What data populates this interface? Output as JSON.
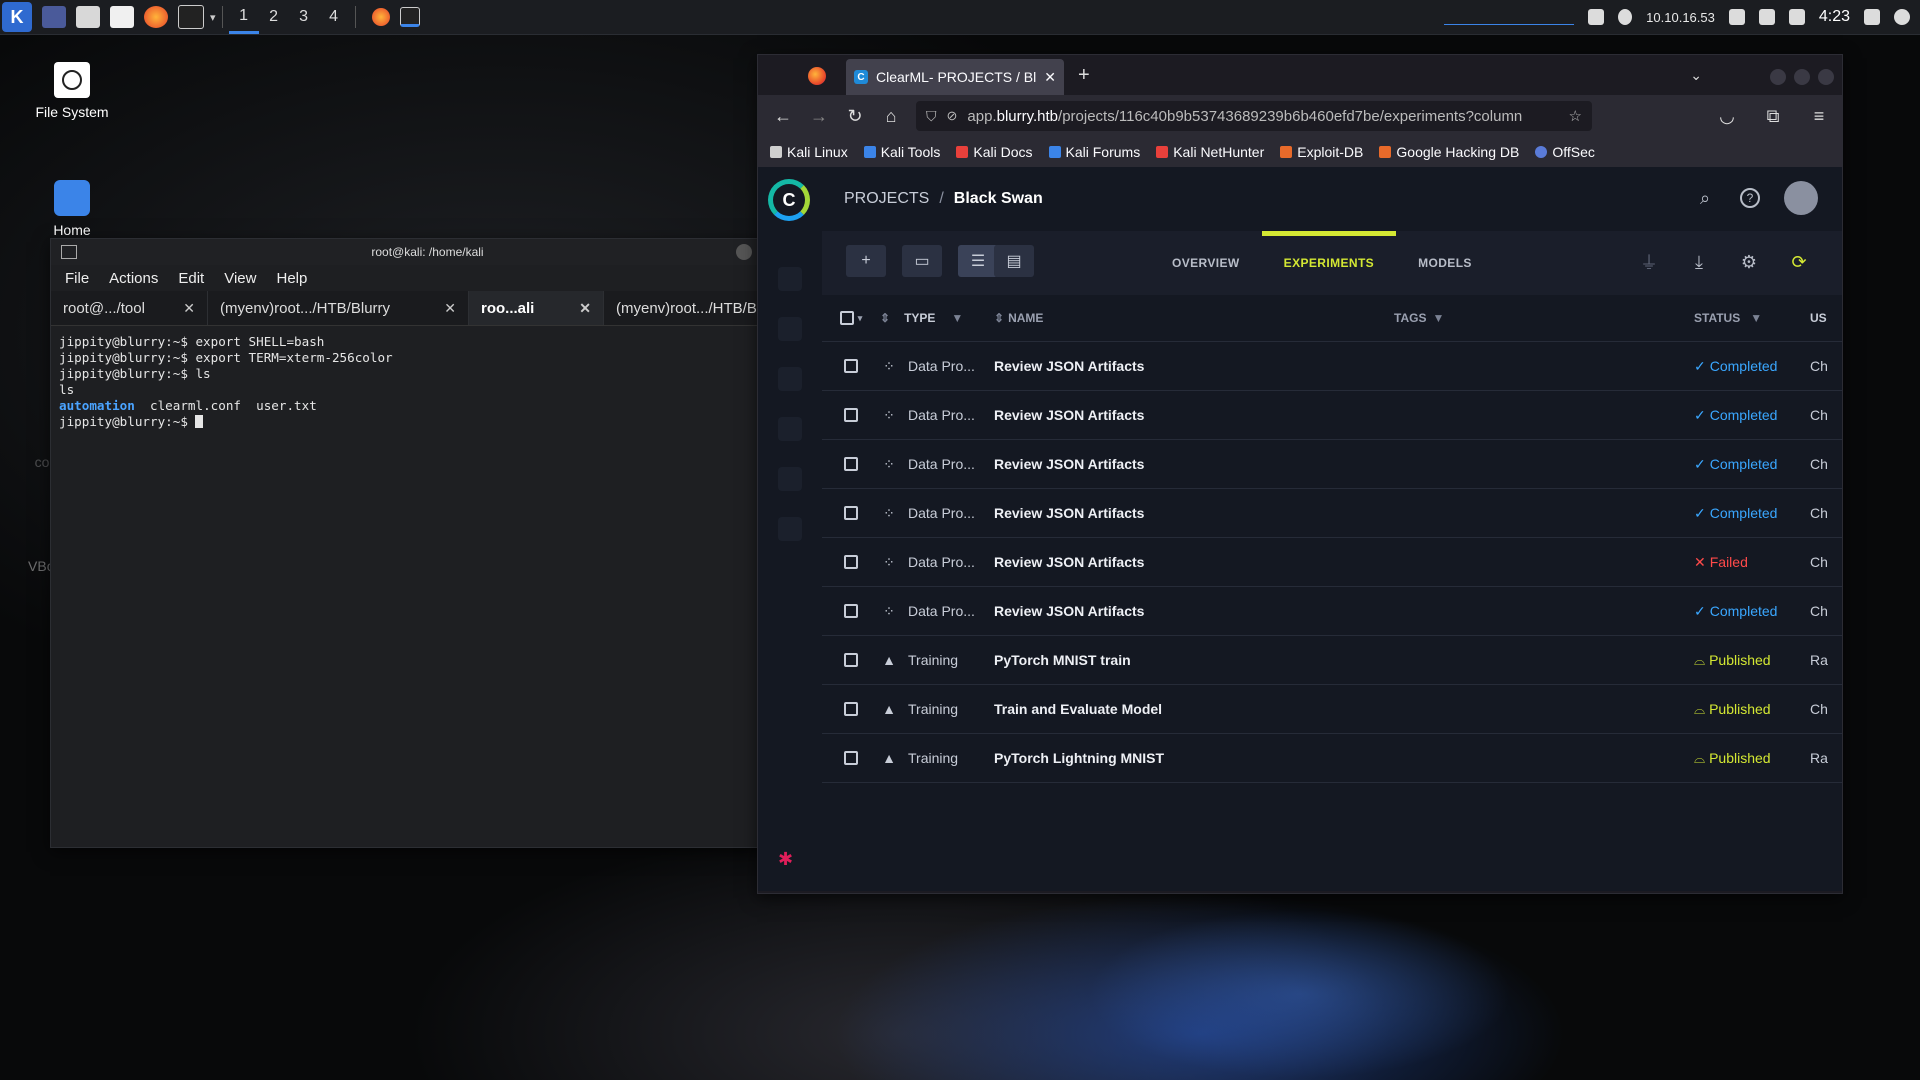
{
  "panel": {
    "workspaces": [
      "1",
      "2",
      "3",
      "4"
    ],
    "active_workspace": "1",
    "ip": "10.10.16.53",
    "clock": "4:23",
    "icons": [
      "kali-menu-icon",
      "desktop-icon",
      "file-manager-icon",
      "text-editor-icon",
      "firefox-icon",
      "terminal-icon"
    ]
  },
  "desktop": {
    "icons": [
      {
        "label": "File System",
        "icon": "drive-icon"
      },
      {
        "label": "Home",
        "icon": "home-folder-icon"
      },
      {
        "label": "comparDDa",
        "icon": "file-icon"
      },
      {
        "label": "VBox_GAs_...",
        "icon": "disc-icon"
      }
    ]
  },
  "terminal": {
    "title": "root@kali: /home/kali",
    "menu": [
      "File",
      "Actions",
      "Edit",
      "View",
      "Help"
    ],
    "tabs": [
      {
        "label": "root@.../tool",
        "active": false
      },
      {
        "label": "(myenv)root.../HTB/Blurry",
        "active": false
      },
      {
        "label": "roo...ali",
        "active": true
      },
      {
        "label": "(myenv)root.../HTB/Blurry",
        "active": false
      }
    ],
    "lines": [
      "jippity@blurry:~$ export SHELL=bash",
      "jippity@blurry:~$ export TERM=xterm-256color",
      "jippity@blurry:~$ ls",
      "ls"
    ],
    "ls_dir": "automation",
    "ls_files": "  clearml.conf  user.txt",
    "prompt": "jippity@blurry:~$ "
  },
  "browser": {
    "tab_title": "ClearML- PROJECTS / Bla",
    "url_prefix": "app.",
    "url_host": "blurry.htb",
    "url_path": "/projects/116c40b9b53743689239b6b460efd7be/experiments?column",
    "bookmarks": [
      "Kali Linux",
      "Kali Tools",
      "Kali Docs",
      "Kali Forums",
      "Kali NetHunter",
      "Exploit-DB",
      "Google Hacking DB",
      "OffSec"
    ],
    "bookmark_colors": [
      "#cfcfcf",
      "#3b84e8",
      "#e8403b",
      "#3b84e8",
      "#e8403b",
      "#e86a2a",
      "#e86a2a",
      "#5a7bd8"
    ]
  },
  "clearml": {
    "logo": "C",
    "breadcrumb_root": "PROJECTS",
    "breadcrumb_sep": "/",
    "breadcrumb_current": "Black Swan",
    "tabs": [
      "OVERVIEW",
      "EXPERIMENTS",
      "MODELS"
    ],
    "active_tab": "EXPERIMENTS",
    "accent": "#d4e833",
    "columns": {
      "type": "TYPE",
      "name": "NAME",
      "tags": "TAGS",
      "status": "STATUS",
      "user": "US"
    },
    "status_colors": {
      "Completed": "#3aa7ff",
      "Failed": "#ff4a4a",
      "Published": "#d4e833"
    },
    "status_glyphs": {
      "Completed": "✓",
      "Failed": "✕",
      "Published": "⌓"
    },
    "rows": [
      {
        "type": "Data Pro...",
        "kind": "data",
        "name": "Review JSON Artifacts",
        "status": "Completed",
        "user": "Ch"
      },
      {
        "type": "Data Pro...",
        "kind": "data",
        "name": "Review JSON Artifacts",
        "status": "Completed",
        "user": "Ch"
      },
      {
        "type": "Data Pro...",
        "kind": "data",
        "name": "Review JSON Artifacts",
        "status": "Completed",
        "user": "Ch"
      },
      {
        "type": "Data Pro...",
        "kind": "data",
        "name": "Review JSON Artifacts",
        "status": "Completed",
        "user": "Ch"
      },
      {
        "type": "Data Pro...",
        "kind": "data",
        "name": "Review JSON Artifacts",
        "status": "Failed",
        "user": "Ch"
      },
      {
        "type": "Data Pro...",
        "kind": "data",
        "name": "Review JSON Artifacts",
        "status": "Completed",
        "user": "Ch"
      },
      {
        "type": "Training",
        "kind": "training",
        "name": "PyTorch MNIST train",
        "status": "Published",
        "user": "Ra"
      },
      {
        "type": "Training",
        "kind": "training",
        "name": "Train and Evaluate Model",
        "status": "Published",
        "user": "Ch"
      },
      {
        "type": "Training",
        "kind": "training",
        "name": "PyTorch Lightning MNIST",
        "status": "Published",
        "user": "Ra"
      }
    ]
  }
}
